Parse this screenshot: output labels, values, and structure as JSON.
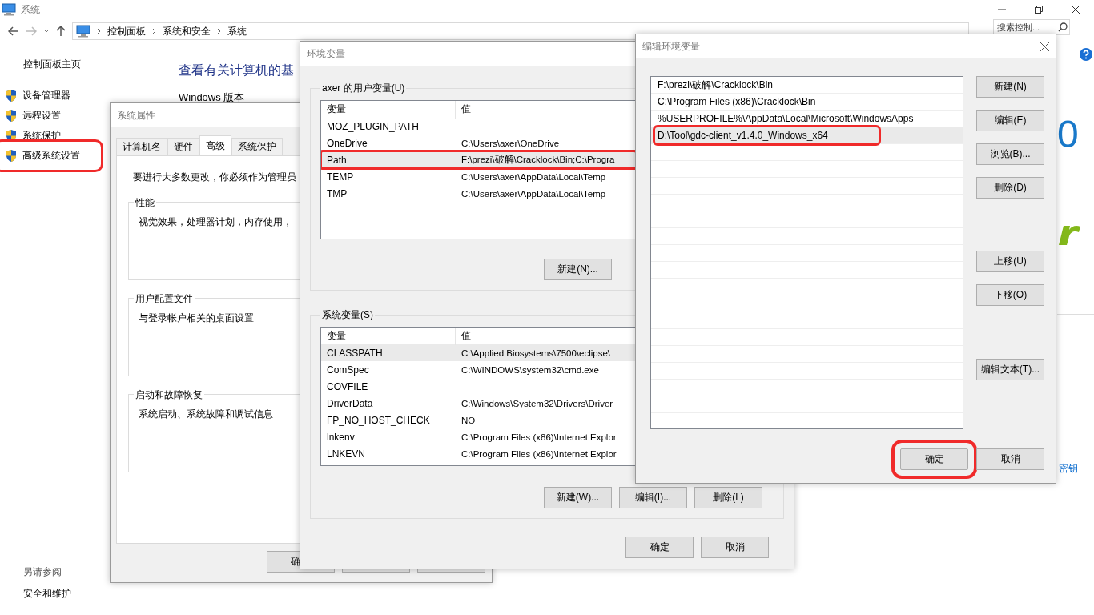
{
  "window": {
    "title": "系统",
    "breadcrumb": [
      "控制面板",
      "系统和安全",
      "系统"
    ],
    "search_placeholder": "搜索控制..."
  },
  "sidebar": {
    "home": "控制面板主页",
    "items": [
      {
        "label": "设备管理器",
        "highlighted": false
      },
      {
        "label": "远程设置",
        "highlighted": false
      },
      {
        "label": "系统保护",
        "highlighted": false
      },
      {
        "label": "高级系统设置",
        "highlighted": true
      }
    ]
  },
  "see_also": {
    "title": "另请参阅",
    "links": [
      "安全和维护"
    ]
  },
  "main": {
    "heading": "查看有关计算机的基",
    "section": "Windows 版本",
    "edition_fragment": "0",
    "link": "密钥"
  },
  "system_properties": {
    "title": "系统属性",
    "tabs": [
      {
        "label": "计算机名",
        "selected": false
      },
      {
        "label": "硬件",
        "selected": false
      },
      {
        "label": "高级",
        "selected": true
      },
      {
        "label": "系统保护",
        "selected": false
      }
    ],
    "notice": "要进行大多数更改，你必须作为管理员",
    "groups": [
      {
        "title": "性能",
        "text": "视觉效果，处理器计划，内存使用，"
      },
      {
        "title": "用户配置文件",
        "text": "与登录帐户相关的桌面设置"
      },
      {
        "title": "启动和故障恢复",
        "text": "系统启动、系统故障和调试信息"
      }
    ],
    "buttons": [
      "确"
    ]
  },
  "environment_variables": {
    "title": "环境变量",
    "user": {
      "title": "axer 的用户变量(U)",
      "columns": [
        "变量",
        "值"
      ],
      "rows": [
        {
          "name": "MOZ_PLUGIN_PATH",
          "selected": false,
          "highlighted": false
        },
        {
          "name": "OneDrive",
          "value": "C:\\Users\\axer\\OneDrive",
          "selected": false,
          "highlighted": false
        },
        {
          "name": "Path",
          "value": "F:\\prezi\\破解\\Cracklock\\Bin;C:\\Progra",
          "selected": true,
          "highlighted": true
        },
        {
          "name": "TEMP",
          "value": "C:\\Users\\axer\\AppData\\Local\\Temp",
          "selected": false,
          "highlighted": false
        },
        {
          "name": "TMP",
          "value": "C:\\Users\\axer\\AppData\\Local\\Temp",
          "selected": false,
          "highlighted": false
        }
      ],
      "buttons": [
        "新建(N)..."
      ]
    },
    "system": {
      "title": "系统变量(S)",
      "columns": [
        "变量",
        "值"
      ],
      "rows": [
        {
          "name": "CLASSPATH",
          "value": "C:\\Applied Biosystems\\7500\\eclipse\\",
          "selected": true,
          "highlighted": false
        },
        {
          "name": "ComSpec",
          "value": "C:\\WINDOWS\\system32\\cmd.exe",
          "selected": false,
          "highlighted": false
        },
        {
          "name": "COVFILE",
          "selected": false,
          "highlighted": false
        },
        {
          "name": "DriverData",
          "value": "C:\\Windows\\System32\\Drivers\\Driver",
          "selected": false,
          "highlighted": false
        },
        {
          "name": "FP_NO_HOST_CHECK",
          "value": "NO",
          "selected": false,
          "highlighted": false
        },
        {
          "name": "lnkenv",
          "value": "C:\\Program Files (x86)\\Internet Explor",
          "selected": false,
          "highlighted": false
        },
        {
          "name": "LNKEVN",
          "value": "C:\\Program Files (x86)\\Internet Explor",
          "selected": false,
          "highlighted": false
        }
      ],
      "buttons": [
        "新建(W)...",
        "编辑(I)...",
        "删除(L)"
      ]
    },
    "buttons": [
      "确定",
      "取消"
    ]
  },
  "edit_dialog": {
    "title": "编辑环境变量",
    "entries": [
      {
        "text": "F:\\prezi\\破解\\Cracklock\\Bin",
        "selected": false,
        "highlighted": false
      },
      {
        "text": "C:\\Program Files (x86)\\Cracklock\\Bin",
        "selected": false,
        "highlighted": false
      },
      {
        "text": "%USERPROFILE%\\AppData\\Local\\Microsoft\\WindowsApps",
        "selected": false,
        "highlighted": false
      },
      {
        "text": "D:\\Tool\\gdc-client_v1.4.0_Windows_x64",
        "selected": true,
        "highlighted": true
      }
    ],
    "side_button_groups": [
      [
        "新建(N)",
        "编辑(E)",
        "浏览(B)...",
        "删除(D)"
      ],
      [
        "上移(U)",
        "下移(O)"
      ],
      [
        "编辑文本(T)..."
      ]
    ],
    "buttons": [
      {
        "label": "确定",
        "highlighted": true
      },
      {
        "label": "取消",
        "highlighted": false
      }
    ]
  }
}
